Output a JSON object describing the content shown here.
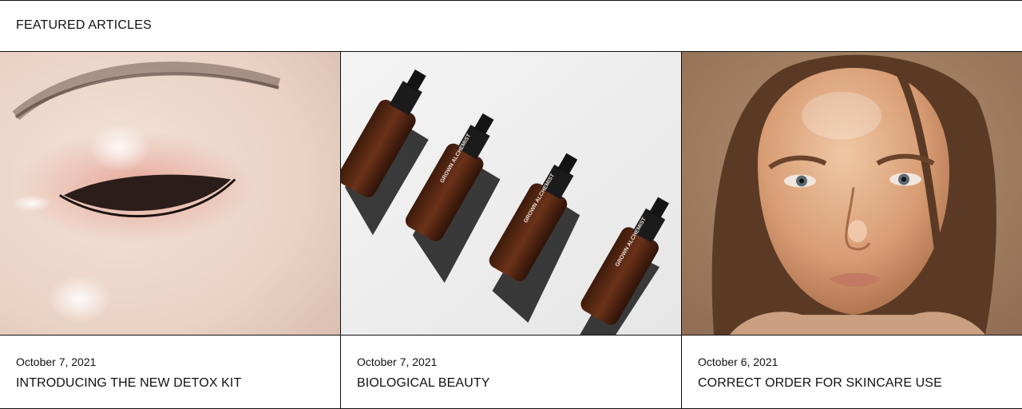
{
  "section": {
    "title": "FEATURED ARTICLES"
  },
  "articles": [
    {
      "date": "October 7, 2021",
      "title": "INTRODUCING THE NEW DETOX KIT",
      "image_icon": "eye-closeup-photo"
    },
    {
      "date": "October 7, 2021",
      "title": "BIOLOGICAL BEAUTY",
      "image_icon": "serum-bottles-photo",
      "bottle_brand": "GROWN ALCHEMIST"
    },
    {
      "date": "October 6, 2021",
      "title": "CORRECT ORDER FOR SKINCARE USE",
      "image_icon": "face-portrait-photo"
    }
  ],
  "colors": {
    "text": "#111111",
    "border": "#111111",
    "background": "#ffffff",
    "bottle": "#5a2a14",
    "portrait_bg": "#9c7a5e"
  }
}
